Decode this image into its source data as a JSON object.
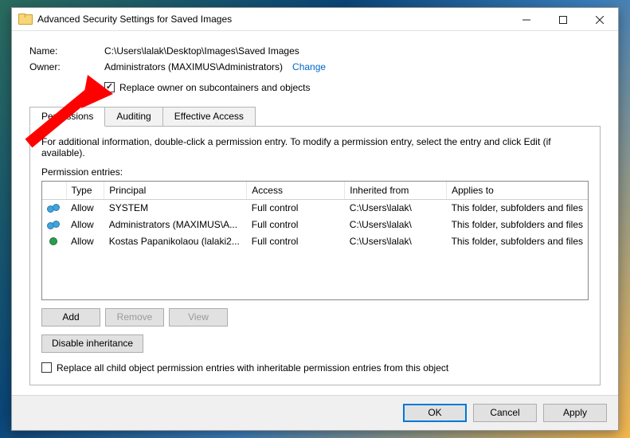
{
  "window": {
    "title": "Advanced Security Settings for Saved Images"
  },
  "fields": {
    "name_label": "Name:",
    "name_value": "C:\\Users\\lalak\\Desktop\\Images\\Saved Images",
    "owner_label": "Owner:",
    "owner_value": "Administrators (MAXIMUS\\Administrators)",
    "change_link": "Change",
    "replace_owner": "Replace owner on subcontainers and objects"
  },
  "tabs": {
    "permissions": "Permissions",
    "auditing": "Auditing",
    "effective": "Effective Access"
  },
  "panel": {
    "info": "For additional information, double-click a permission entry. To modify a permission entry, select the entry and click Edit (if available).",
    "entries_label": "Permission entries:"
  },
  "columns": {
    "type": "Type",
    "principal": "Principal",
    "access": "Access",
    "inherited": "Inherited from",
    "applies": "Applies to"
  },
  "entries": [
    {
      "type": "Allow",
      "principal": "SYSTEM",
      "access": "Full control",
      "inherited": "C:\\Users\\lalak\\",
      "applies": "This folder, subfolders and files",
      "icon": "group"
    },
    {
      "type": "Allow",
      "principal": "Administrators (MAXIMUS\\A...",
      "access": "Full control",
      "inherited": "C:\\Users\\lalak\\",
      "applies": "This folder, subfolders and files",
      "icon": "group"
    },
    {
      "type": "Allow",
      "principal": "Kostas Papanikolaou (lalaki2...",
      "access": "Full control",
      "inherited": "C:\\Users\\lalak\\",
      "applies": "This folder, subfolders and files",
      "icon": "single"
    }
  ],
  "buttons": {
    "add": "Add",
    "remove": "Remove",
    "view": "View",
    "disable_inheritance": "Disable inheritance",
    "replace_child": "Replace all child object permission entries with inheritable permission entries from this object",
    "ok": "OK",
    "cancel": "Cancel",
    "apply": "Apply"
  }
}
